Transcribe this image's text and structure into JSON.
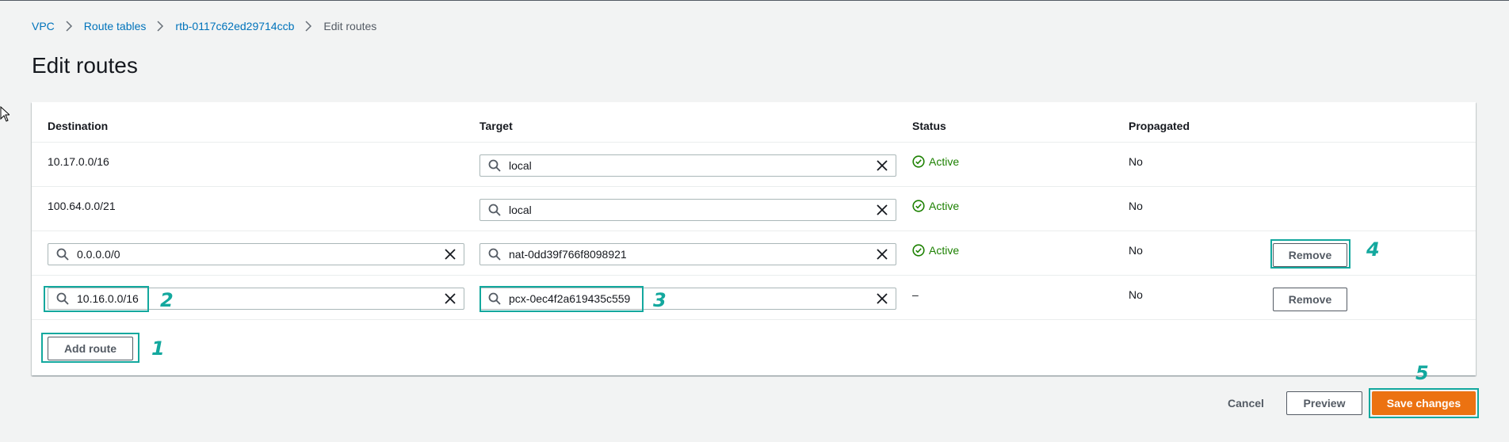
{
  "breadcrumb": {
    "items": [
      "VPC",
      "Route tables",
      "rtb-0117c62ed29714ccb"
    ],
    "current": "Edit routes"
  },
  "page": {
    "title": "Edit routes"
  },
  "table": {
    "columns": [
      "Destination",
      "Target",
      "Status",
      "Propagated"
    ],
    "rows": [
      {
        "destination": "10.17.0.0/16",
        "target": "local",
        "status": "Active",
        "propagated": "No"
      },
      {
        "destination": "100.64.0.0/21",
        "target": "local",
        "status": "Active",
        "propagated": "No"
      },
      {
        "destination": "0.0.0.0/0",
        "target": "nat-0dd39f766f8098921",
        "status": "Active",
        "propagated": "No",
        "remove_label": "Remove"
      },
      {
        "destination": "10.16.0.0/16",
        "target": "pcx-0ec4f2a619435c559",
        "status": "–",
        "propagated": "No",
        "remove_label": "Remove"
      }
    ],
    "add_route_label": "Add route"
  },
  "actions": {
    "cancel": "Cancel",
    "preview": "Preview",
    "save": "Save changes"
  },
  "annotations": [
    "1",
    "2",
    "3",
    "4",
    "5"
  ],
  "colors": {
    "accent_link": "#0073bb",
    "primary": "#ec7211",
    "success": "#1d8102",
    "annotation": "#13a89e"
  },
  "icons": [
    "chevron-right-icon",
    "search-icon",
    "clear-icon",
    "status-success-icon",
    "mouse-cursor-icon"
  ]
}
